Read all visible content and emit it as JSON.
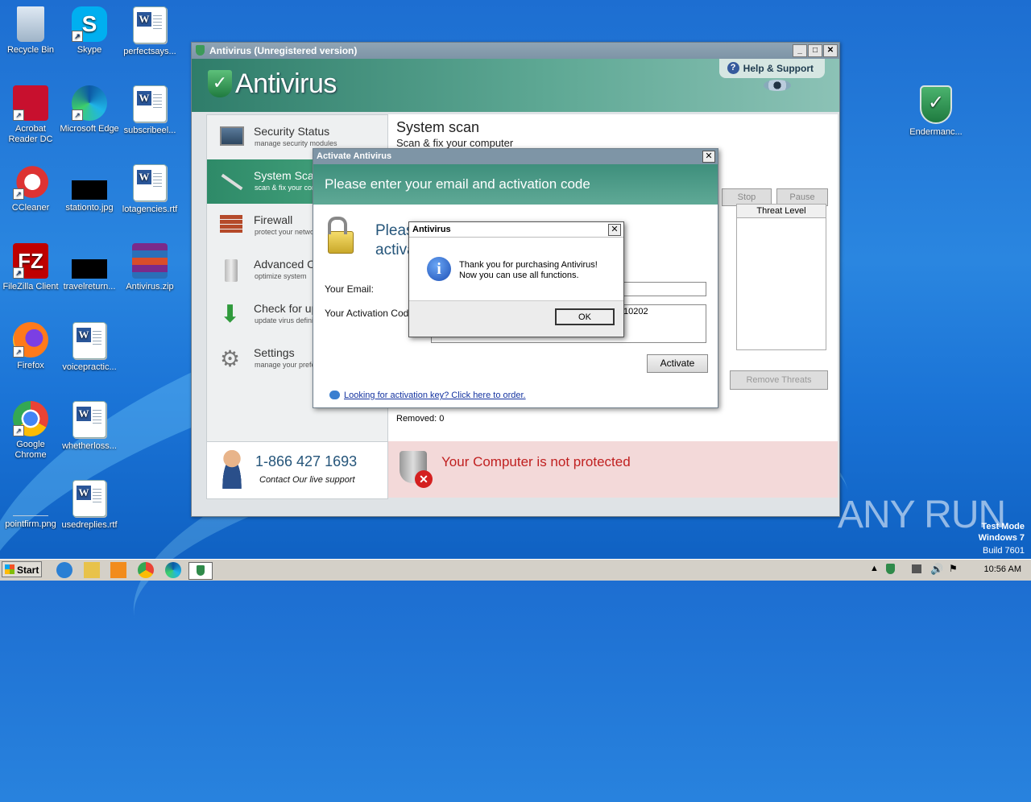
{
  "desktop": {
    "icons": [
      {
        "label": "Recycle Bin"
      },
      {
        "label": "Skype"
      },
      {
        "label": "perfectsays..."
      },
      {
        "label": "Acrobat Reader DC"
      },
      {
        "label": "Microsoft Edge"
      },
      {
        "label": "subscribeel..."
      },
      {
        "label": "CCleaner"
      },
      {
        "label": "stationto.jpg"
      },
      {
        "label": "lotagencies.rtf"
      },
      {
        "label": "FileZilla Client"
      },
      {
        "label": "travelreturn..."
      },
      {
        "label": "Antivirus.zip"
      },
      {
        "label": "Firefox"
      },
      {
        "label": "voicepractic..."
      },
      {
        "label": "Google Chrome"
      },
      {
        "label": "whetherloss..."
      },
      {
        "label": "pointfirm.png"
      },
      {
        "label": "usedreplies.rtf"
      },
      {
        "label": "Endermanc..."
      }
    ],
    "watermark": {
      "l1": "Test Mode",
      "l2": "Windows 7",
      "l3": "Build 7601"
    },
    "anyrun": "ANY RUN"
  },
  "main_window": {
    "title": "Antivirus (Unregistered version)",
    "brand": "Antivirus",
    "help": "Help & Support",
    "nav": [
      {
        "title": "Security Status",
        "sub": "manage security modules"
      },
      {
        "title": "System Scan",
        "sub": "scan & fix your computer"
      },
      {
        "title": "Firewall",
        "sub": "protect your network"
      },
      {
        "title": "Advanced Care",
        "sub": "optimize system"
      },
      {
        "title": "Check for updates",
        "sub": "update virus definitions"
      },
      {
        "title": "Settings",
        "sub": "manage your preferences"
      }
    ],
    "phone": "1-866 427 1693",
    "contact": "Contact Our live support",
    "content_title": "System scan",
    "content_sub": "Scan & fix your computer",
    "stop": "Stop",
    "pause": "Pause",
    "col_threat": "Threat Level",
    "remove_threats": "Remove Threats",
    "removed": "Removed: 0",
    "alert": "Your Computer is not protected"
  },
  "activate_dialog": {
    "title": "Activate Antivirus",
    "header": "Please enter your email and activation code",
    "lead1": "Please",
    "lead2": "activation code",
    "email_label": "Your Email:",
    "code_label": "Your Activation Code:",
    "code_value": "10202",
    "activate": "Activate",
    "link": "Looking for activation key? Click here to order."
  },
  "message_box": {
    "title": "Antivirus",
    "line1": "Thank you for purchasing Antivirus!",
    "line2": "Now you can use all functions.",
    "ok": "OK"
  },
  "taskbar": {
    "start": "Start",
    "time": "10:56 AM"
  }
}
